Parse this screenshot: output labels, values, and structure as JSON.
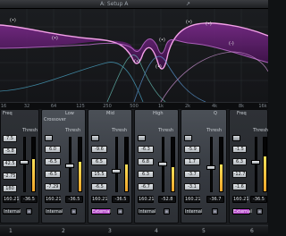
{
  "header": {
    "setup": "A: Setup A",
    "arrow": "↗"
  },
  "graph": {
    "node_labels": [
      "(•)",
      "(•)",
      "(•)",
      "(•)",
      "(•)",
      "(•)",
      "(•)",
      "(-)"
    ]
  },
  "freq_scale": [
    "16",
    "32",
    "64",
    "125",
    "250",
    "500",
    "1k",
    "2k",
    "4k",
    "8k",
    "16k"
  ],
  "bands": [
    {
      "head": "Freq",
      "thresh": "Thresh",
      "fields": [
        "7.5",
        "-5.8",
        "42.5",
        "-2.75",
        "180",
        "160.21"
      ],
      "readout": "-36.5",
      "sc": "Internal",
      "sc_active": false,
      "fader": 0.62,
      "meter": 0.6
    },
    {
      "head": "Crossover",
      "thresh": "Thresh",
      "fields": [
        "6.0",
        "-6.5",
        "-6.5",
        "-7.29",
        "160.21"
      ],
      "readout": "-36.5",
      "sc": "Internal",
      "sc_active": false,
      "fader": 0.55,
      "meter": 0.55,
      "extra_top": "Low"
    },
    {
      "head": "Mid",
      "thresh": "Thresh",
      "fields": [
        "-9.6",
        "6.5",
        "15.5",
        "-6.5",
        "160.21"
      ],
      "readout": "-36.5",
      "sc": "External",
      "sc_active": true,
      "fader": 0.4,
      "meter": 0.5
    },
    {
      "head": "High",
      "thresh": "Thresh",
      "fields": [
        "-6.3",
        "6.8",
        "6.3",
        "-6.7",
        "160.21"
      ],
      "readout": "-52.8",
      "sc": "Internal",
      "sc_active": false,
      "fader": 0.55,
      "meter": 0.45
    },
    {
      "head": "Q",
      "thresh": "Thresh",
      "fields": [
        "-5.9",
        "1.7",
        "-3.7",
        "-3.1",
        "160.21"
      ],
      "readout": "-36.7",
      "sc": "Internal",
      "sc_active": false,
      "fader": 0.5,
      "meter": 0.5
    },
    {
      "head": "Freq",
      "thresh": "Thresh",
      "fields": [
        "-1.5",
        "6.3",
        "-12.7",
        "-1.6",
        "160.21"
      ],
      "readout": "-36.5",
      "sc": "External",
      "sc_active": true,
      "fader": 0.6,
      "meter": 0.65
    }
  ],
  "bottom": [
    "1",
    "2",
    "3",
    "4",
    "5",
    "6"
  ],
  "colors": {
    "curve": "#f3a0e8",
    "fill": "#6c1f7a",
    "accent": "#b03ec6",
    "meter": "#f0a52a"
  }
}
